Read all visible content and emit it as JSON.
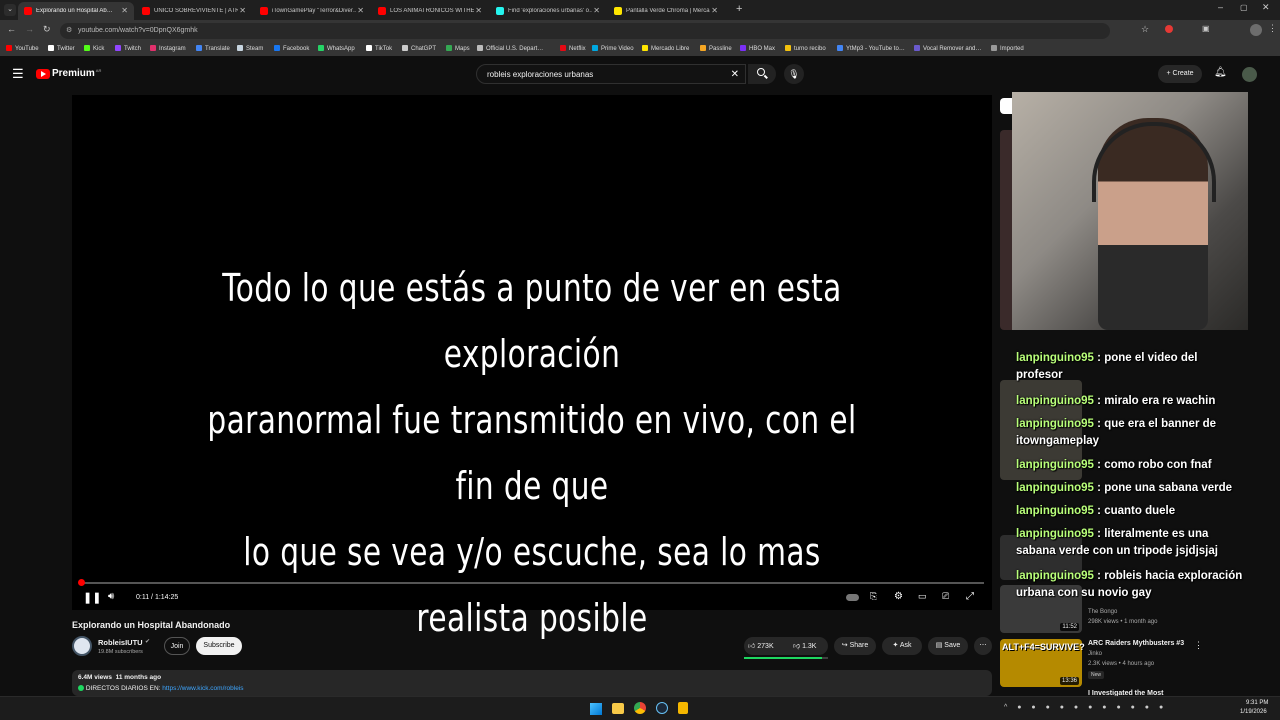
{
  "browser": {
    "tabs": [
      {
        "label": "Explorando un Hospital Ab…",
        "active": true,
        "favicon_color": "#ff0000"
      },
      {
        "label": "UNICO SOBREVIVIENTE | ATRAP",
        "active": false,
        "favicon_color": "#ff0000"
      },
      {
        "label": "iTownGamePlay \"Terror&Diver…",
        "active": false,
        "favicon_color": "#ff0000"
      },
      {
        "label": "LOS ANIMATRÓNICOS WITHER…",
        "active": false,
        "favicon_color": "#ff0000"
      },
      {
        "label": "Find 'exploraciones urbanas' o…",
        "active": false,
        "favicon_color": "#25f4ee"
      },
      {
        "label": "Pantalla Verde Chroma | Merca…",
        "active": false,
        "favicon_color": "#ffe600"
      }
    ],
    "url": "youtube.com/watch?v=0DpnQX6gmhk",
    "bookmarks": [
      {
        "label": "YouTube",
        "color": "#ff0000"
      },
      {
        "label": "Twitter",
        "color": "#ffffff"
      },
      {
        "label": "Kick",
        "color": "#53fc18"
      },
      {
        "label": "Twitch",
        "color": "#9146ff"
      },
      {
        "label": "Instagram",
        "color": "#e1306c"
      },
      {
        "label": "Translate",
        "color": "#4285f4"
      },
      {
        "label": "Steam",
        "color": "#c7d5e0"
      },
      {
        "label": "Facebook",
        "color": "#1877f2"
      },
      {
        "label": "WhatsApp",
        "color": "#25d366"
      },
      {
        "label": "TikTok",
        "color": "#ffffff"
      },
      {
        "label": "ChatGPT",
        "color": "#cccccc"
      },
      {
        "label": "Maps",
        "color": "#34a853"
      },
      {
        "label": "Official U.S. Depart…",
        "color": "#bbbbbb"
      },
      {
        "label": "Netflix",
        "color": "#e50914"
      },
      {
        "label": "Prime Video",
        "color": "#00a8e1"
      },
      {
        "label": "Mercado Libre",
        "color": "#ffe600"
      },
      {
        "label": "Passline",
        "color": "#f5a623"
      },
      {
        "label": "HBO Max",
        "color": "#7b2ff7"
      },
      {
        "label": "turno recibo",
        "color": "#f4c20d"
      },
      {
        "label": "YtMp3 - YouTube to…",
        "color": "#4285f4"
      },
      {
        "label": "Vocal Remover and…",
        "color": "#6a5acd"
      },
      {
        "label": "Imported",
        "color": "#999999"
      }
    ]
  },
  "youtube": {
    "logo_text": "Premium",
    "logo_sup": "AR",
    "search_value": "robleis exploraciones urbanas",
    "create_label": "Create"
  },
  "video": {
    "overlay_text_lines": [
      "Todo lo que estás a punto de ver en esta exploración",
      "paranormal fue transmitido en vivo, con el fin de que",
      "lo que se vea y/o escuche, sea lo mas realista posible"
    ],
    "time": "0:11 / 1:14:25",
    "progress": 0.0025,
    "title": "Explorando un Hospital Abandonado",
    "channel": "RobleisIUTU",
    "subscribers": "19.8M subscribers",
    "join_label": "Join",
    "subscribe_label": "Subscribe",
    "likes": "273K",
    "dislikes": "1.3K",
    "share_label": "Share",
    "ask_label": "Ask",
    "save_label": "Save",
    "views_date": "6.4M views  11 months ago",
    "description_prefix": "DIRECTOS DIARIOS EN: ",
    "description_link": "https://www.kick.com/robleis"
  },
  "chat": [
    {
      "user": "lanpinguino95",
      "msg": "pone el video del profesor"
    },
    {
      "user": "lanpinguino95",
      "msg": "miralo era re wachin"
    },
    {
      "user": "lanpinguino95",
      "msg": "que era el banner de itowngameplay"
    },
    {
      "user": "lanpinguino95",
      "msg": "como robo con fnaf"
    },
    {
      "user": "lanpinguino95",
      "msg": "pone una sabana verde"
    },
    {
      "user": "lanpinguino95",
      "msg": "cuanto duele"
    },
    {
      "user": "lanpinguino95",
      "msg": "literalmente es una sabana verde con un tripode jsjdjsjaj"
    },
    {
      "user": "lanpinguino95",
      "msg": "robleis hacia exploración urbana con su novio gay"
    }
  ],
  "sidebar": {
    "items": [
      {
        "duration": "11:52",
        "title": "",
        "channel": "The Bongo",
        "meta": "298K views • 1 month ago",
        "color": "#6b3a2a"
      },
      {
        "duration": "13:36",
        "title": "ARC Raiders Mythbusters #3",
        "channel": "Jinko",
        "meta": "2.3K views • 4 hours ago",
        "badge": "New",
        "color": "#e0b000",
        "thumb_text": "ALT+F4=SURVIVE?"
      },
      {
        "duration": "",
        "title": "I Investigated the Most",
        "channel": "",
        "meta": "",
        "color": "#444444"
      }
    ]
  },
  "taskbar": {
    "time": "9:31 PM",
    "date": "1/19/2026"
  }
}
